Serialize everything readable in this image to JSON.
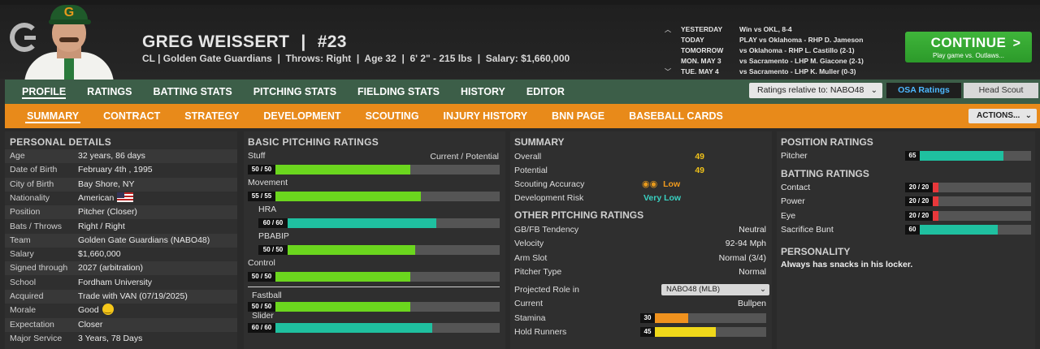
{
  "player": {
    "name": "GREG WEISSERT",
    "separator": "|",
    "number": "#23",
    "subtitle": "CL | Golden Gate Guardians  |  Throws: Right  |  Age 32  |  6' 2\" - 215 lbs  |  Salary: $1,660,000"
  },
  "schedule": [
    {
      "day": "YESTERDAY",
      "result": "Win vs OKL, 8-4"
    },
    {
      "day": "TODAY",
      "result": "PLAY vs Oklahoma - RHP D. Jameson"
    },
    {
      "day": "TOMORROW",
      "result": "vs Oklahoma - RHP L. Castillo (2-1)"
    },
    {
      "day": "MON. MAY 3",
      "result": "vs Sacramento - LHP M. Giacone (2-1)"
    },
    {
      "day": "TUE. MAY 4",
      "result": "vs Sacramento - LHP K. Muller (0-3)"
    }
  ],
  "continue_button": {
    "label": "CONTINUE",
    "arrow": ">",
    "sub": "Play game vs. Outlaws..."
  },
  "main_tabs": [
    "PROFILE",
    "RATINGS",
    "BATTING STATS",
    "PITCHING STATS",
    "FIELDING STATS",
    "HISTORY",
    "EDITOR"
  ],
  "ratings_relative": {
    "label": "Ratings relative to: NABO48",
    "chevron": "⌄"
  },
  "ratings_source": {
    "osa": "OSA Ratings",
    "scout": "Head Scout"
  },
  "sub_tabs": [
    "SUMMARY",
    "CONTRACT",
    "STRATEGY",
    "DEVELOPMENT",
    "SCOUTING",
    "INJURY HISTORY",
    "BNN PAGE",
    "BASEBALL CARDS"
  ],
  "actions": {
    "label": "ACTIONS...",
    "chevron": "⌄"
  },
  "personal_details": {
    "title": "PERSONAL DETAILS",
    "rows": [
      {
        "label": "Age",
        "value": "32 years, 86 days"
      },
      {
        "label": "Date of Birth",
        "value": "February 4th , 1995"
      },
      {
        "label": "City of Birth",
        "value": "Bay Shore, NY"
      },
      {
        "label": "Nationality",
        "value": "American"
      },
      {
        "label": "Position",
        "value": "Pitcher (Closer)"
      },
      {
        "label": "Bats / Throws",
        "value": "Right / Right"
      },
      {
        "label": "Team",
        "value": "Golden Gate Guardians (NABO48)"
      },
      {
        "label": "Salary",
        "value": "$1,660,000"
      },
      {
        "label": "Signed through",
        "value": "2027 (arbitration)"
      },
      {
        "label": "School",
        "value": "Fordham University"
      },
      {
        "label": "Acquired",
        "value": "Trade with VAN (07/19/2025)"
      },
      {
        "label": "Morale",
        "value": "Good"
      },
      {
        "label": "Expectation",
        "value": "Closer"
      },
      {
        "label": "Major Service",
        "value": "3 Years, 78 Days"
      }
    ]
  },
  "basic_pitching": {
    "title": "BASIC PITCHING RATINGS",
    "col_header": "Current / Potential",
    "ratings": [
      {
        "name": "Stuff",
        "text": "50 / 50",
        "level": 0.6,
        "color": "#6bd61e",
        "indent": false
      },
      {
        "name": "Movement",
        "text": "55 / 55",
        "level": 0.65,
        "color": "#6bd61e",
        "indent": false
      },
      {
        "name": "HRA",
        "text": "60 / 60",
        "level": 0.7,
        "color": "#1fc0a0",
        "indent": true
      },
      {
        "name": "PBABIP",
        "text": "50 / 50",
        "level": 0.6,
        "color": "#6bd61e",
        "indent": true
      },
      {
        "name": "Control",
        "text": "50 / 50",
        "level": 0.6,
        "color": "#6bd61e",
        "indent": false
      }
    ],
    "pitches": [
      {
        "name": "Fastball",
        "text": "50 / 50",
        "level": 0.6,
        "color": "#6bd61e"
      },
      {
        "name": "Slider",
        "text": "60 / 60",
        "level": 0.7,
        "color": "#1fc0a0"
      }
    ]
  },
  "summary": {
    "title": "SUMMARY",
    "overall": {
      "label": "Overall",
      "value": "49"
    },
    "potential": {
      "label": "Potential",
      "value": "49"
    },
    "scouting_accuracy": {
      "label": "Scouting Accuracy",
      "value": "Low",
      "icon": "binoculars"
    },
    "development_risk": {
      "label": "Development Risk",
      "value": "Very Low"
    }
  },
  "other_pitching": {
    "title": "OTHER PITCHING RATINGS",
    "rows": [
      {
        "label": "GB/FB Tendency",
        "value": "Neutral"
      },
      {
        "label": "Velocity",
        "value": "92-94 Mph"
      },
      {
        "label": "Arm Slot",
        "value": "Normal (3/4)"
      },
      {
        "label": "Pitcher Type",
        "value": "Normal"
      }
    ],
    "projected_role": {
      "label": "Projected Role in",
      "select": "NABO48 (MLB)",
      "chevron": "⌄"
    },
    "current": {
      "label": "Current",
      "value": "Bullpen"
    },
    "stamina": {
      "label": "Stamina",
      "value": "30",
      "level": 0.3,
      "color": "#f0921e"
    },
    "hold_runners": {
      "label": "Hold Runners",
      "value": "45",
      "level": 0.55,
      "color": "#f0d81a"
    }
  },
  "position_ratings": {
    "title": "POSITION RATINGS",
    "rows": [
      {
        "label": "Pitcher",
        "value": "65",
        "level": 0.75,
        "color": "#1fc0a0"
      }
    ]
  },
  "batting_ratings": {
    "title": "BATTING RATINGS",
    "rows": [
      {
        "label": "Contact",
        "value": "20 / 20",
        "level": 0.06,
        "color": "#e8383b"
      },
      {
        "label": "Power",
        "value": "20 / 20",
        "level": 0.06,
        "color": "#e8383b"
      },
      {
        "label": "Eye",
        "value": "20 / 20",
        "level": 0.06,
        "color": "#e8383b"
      },
      {
        "label": "Sacrifice Bunt",
        "value": "60",
        "level": 0.7,
        "color": "#1fc0a0"
      }
    ]
  },
  "personality": {
    "title": "PERSONALITY",
    "text": "Always has snacks in his locker."
  }
}
